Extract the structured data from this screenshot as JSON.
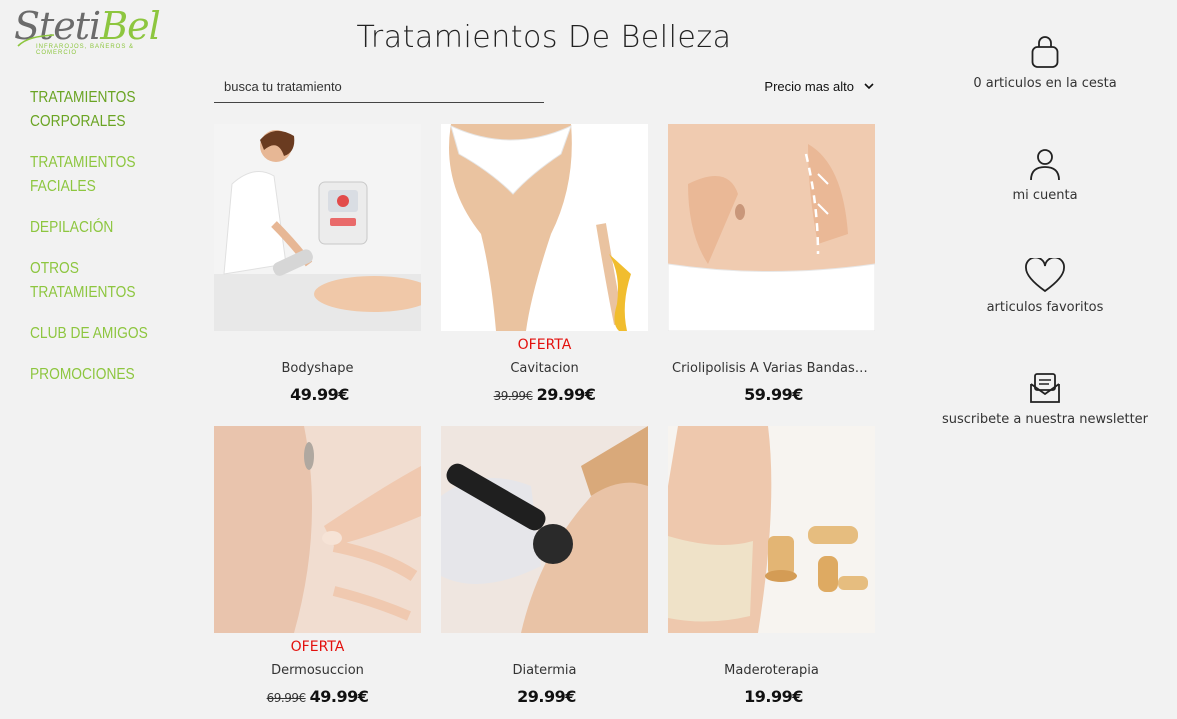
{
  "logo": {
    "text_main": "Steti",
    "text_accent": "Bel",
    "tagline": "INFRAROJOS, BAÑEROS & COMERCIO"
  },
  "nav": [
    {
      "label": "TRATAMIENTOS CORPORALES"
    },
    {
      "label": "TRATAMIENTOS FACIALES"
    },
    {
      "label": "DEPILACIÓN"
    },
    {
      "label": "OTROS TRATAMIENTOS"
    },
    {
      "label": "CLUB DE AMIGOS"
    },
    {
      "label": "PROMOCIONES"
    }
  ],
  "page": {
    "title": "Tratamientos De Belleza"
  },
  "search": {
    "placeholder": "busca tu tratamiento"
  },
  "sort": {
    "selected": "Precio mas alto"
  },
  "products": [
    {
      "name": "Bodyshape",
      "oferta": "",
      "old_price": "",
      "price": "49.99€"
    },
    {
      "name": "Cavitacion",
      "oferta": "OFERTA",
      "old_price": "39.99€",
      "price": "29.99€"
    },
    {
      "name": "Criolipolisis A Varias Bandas ...",
      "oferta": "",
      "old_price": "",
      "price": "59.99€"
    },
    {
      "name": "Dermosuccion",
      "oferta": "OFERTA",
      "old_price": "69.99€",
      "price": "49.99€"
    },
    {
      "name": "Diatermia",
      "oferta": "",
      "old_price": "",
      "price": "29.99€"
    },
    {
      "name": "Maderoterapia",
      "oferta": "",
      "old_price": "",
      "price": "19.99€"
    }
  ],
  "side": {
    "cart": {
      "icon": "bag-icon",
      "label": "0 articulos en la cesta"
    },
    "account": {
      "icon": "user-icon",
      "label": "mi cuenta"
    },
    "favorites": {
      "icon": "heart-icon",
      "label": "articulos favoritos"
    },
    "newsletter": {
      "icon": "mail-icon",
      "label": "suscribete a nuestra newsletter"
    }
  },
  "colors": {
    "brand_green": "#8dc63f",
    "oferta_red": "#e3100d",
    "background": "#f2f2f2"
  }
}
